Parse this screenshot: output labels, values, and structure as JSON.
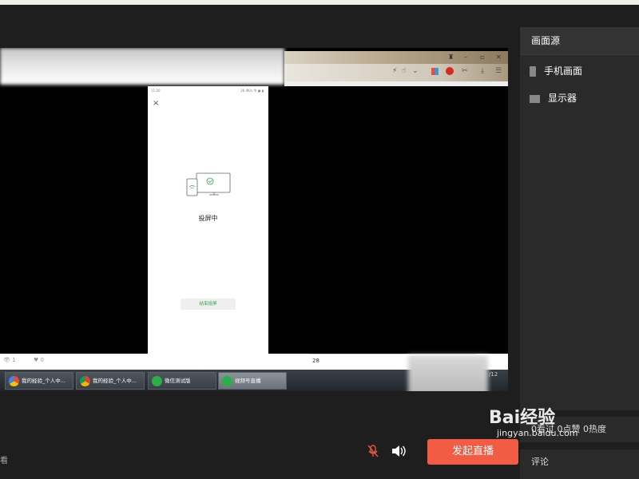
{
  "top": {
    "bookmarks": [
      "",
      "",
      "",
      "",
      "",
      "",
      "",
      ""
    ]
  },
  "capture": {
    "window_controls": [
      "♜",
      "–",
      "▫",
      "✕"
    ],
    "phone": {
      "status_left": "11:20",
      "status_right": "26.4K/s 令 ▣ ▮",
      "close": "×",
      "title": "投屏中",
      "end_button": "结束投屏",
      "nav": [
        "≡",
        "□",
        "‹"
      ]
    },
    "stats": {
      "views": "1",
      "likes": "0"
    },
    "input_value": "28",
    "taskbar": [
      {
        "label": "我的经验_个人中...",
        "color": "#e84b3a",
        "active": false
      },
      {
        "label": "我的经验_个人中...",
        "color": "#3a87e8",
        "active": false
      },
      {
        "label": "微信测试版",
        "color": "#2aae48",
        "active": false
      },
      {
        "label": "视频号直播",
        "color": "#2aae48",
        "active": true
      }
    ],
    "tray": "/12"
  },
  "panel": {
    "header": "画面源",
    "items": [
      {
        "label": "手机画面",
        "icon": "phone-icon"
      },
      {
        "label": "显示器",
        "icon": "monitor-icon"
      }
    ]
  },
  "stats_box": "0看过  0点赞  0热度",
  "comment_box": "评论",
  "controls": {
    "live_button": "发起直播",
    "left_bottom": "看"
  },
  "watermark": {
    "brand": "Bai经验",
    "url": "jingyan.baidu.com"
  },
  "colors": {
    "accent": "#f25c45",
    "mic_muted": "#e8553e",
    "phone_green": "#2aa84a"
  }
}
